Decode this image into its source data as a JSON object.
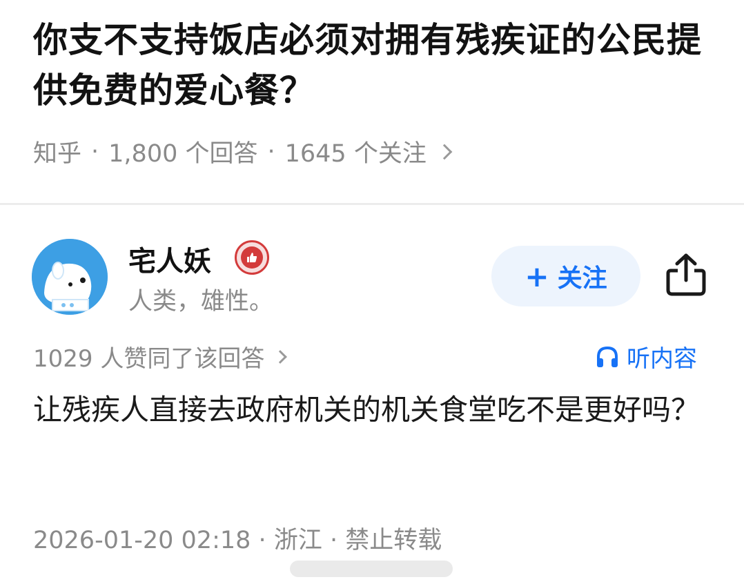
{
  "question": {
    "title": "你支不支持饭店必须对拥有残疾证的公民提供免费的爱心餐？",
    "source": "知乎",
    "answers": "1,800 个回答",
    "followers": "1645 个关注",
    "separator": "·"
  },
  "author": {
    "name": "宅人妖",
    "bio": "人类，雄性。",
    "follow_plus": "+",
    "follow_label": "关注"
  },
  "answer": {
    "votes": "1029 人赞同了该回答",
    "listen_label": "听内容",
    "body": "让残疾人直接去政府机关的机关食堂吃不是更好吗？",
    "datetime": "2026-01-20 02:18",
    "location": "浙江",
    "copyright": "禁止转载"
  },
  "icons": {
    "chevron": "chevron-right-icon",
    "share": "share-icon",
    "headphones": "headphones-icon",
    "badge": "thumbs-up-badge-icon"
  },
  "colors": {
    "accent": "#1772f6",
    "follow_bg": "#edf4fd",
    "meta_text": "#8a8a8a",
    "badge_red": "#d33b3b"
  }
}
